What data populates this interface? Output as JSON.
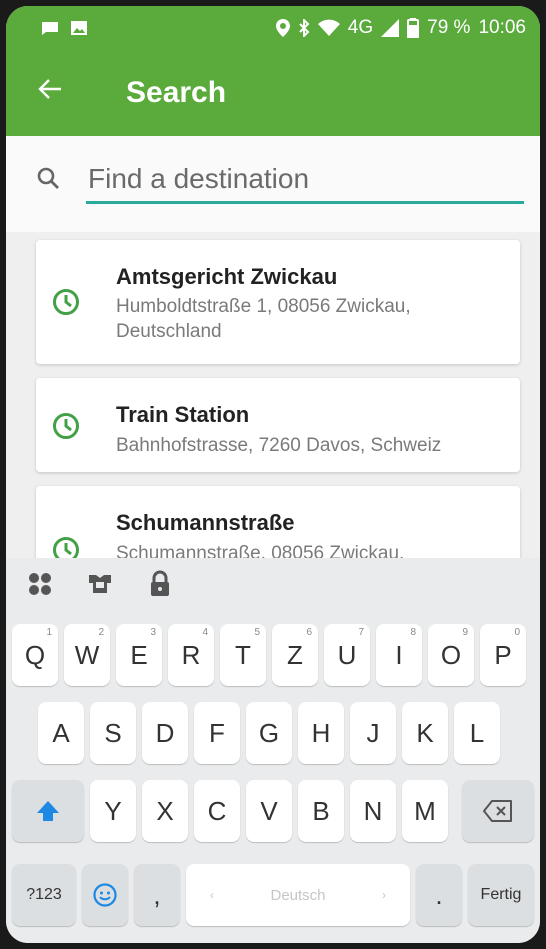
{
  "status_bar": {
    "time": "10:06",
    "battery": "79 %",
    "network": "4G",
    "icons": [
      "message-icon",
      "image-icon",
      "location-icon",
      "bluetooth-icon",
      "wifi-icon",
      "signal-icon",
      "battery-icon"
    ]
  },
  "app_bar": {
    "title": "Search",
    "back_icon": "back-arrow-icon",
    "color": "#5aaa3c"
  },
  "search": {
    "placeholder": "Find a destination",
    "value": "",
    "underline_color": "#2aa89a"
  },
  "results": [
    {
      "name": "Amtsgericht Zwickau",
      "address_line1": "Humboldtstraße 1, 08056 Zwickau,",
      "address_line2": "Deutschland",
      "icon": "history-clock-icon"
    },
    {
      "name": "Train Station",
      "address_line1": "Bahnhofstrasse, 7260 Davos, Schweiz",
      "address_line2": "",
      "icon": "history-clock-icon"
    },
    {
      "name": "Schumannstraße",
      "address_line1": "Schumannstraße, 08056 Zwickau,",
      "address_line2": "",
      "icon": "history-clock-icon"
    }
  ],
  "keyboard": {
    "tools": [
      "apps-icon",
      "theme-shirt-icon",
      "lock-icon"
    ],
    "row1": [
      "Q",
      "W",
      "E",
      "R",
      "T",
      "Z",
      "U",
      "I",
      "O",
      "P"
    ],
    "row1_numbers": [
      "1",
      "2",
      "3",
      "4",
      "5",
      "6",
      "7",
      "8",
      "9",
      "0"
    ],
    "row2": [
      "A",
      "S",
      "D",
      "F",
      "G",
      "H",
      "J",
      "K",
      "L"
    ],
    "row3": [
      "Y",
      "X",
      "C",
      "V",
      "B",
      "N",
      "M"
    ],
    "symbols_label": "?123",
    "comma_label": ",",
    "space_label": "Deutsch",
    "period_label": ".",
    "done_label": "Fertig",
    "accent_color": "#1e88e5"
  }
}
